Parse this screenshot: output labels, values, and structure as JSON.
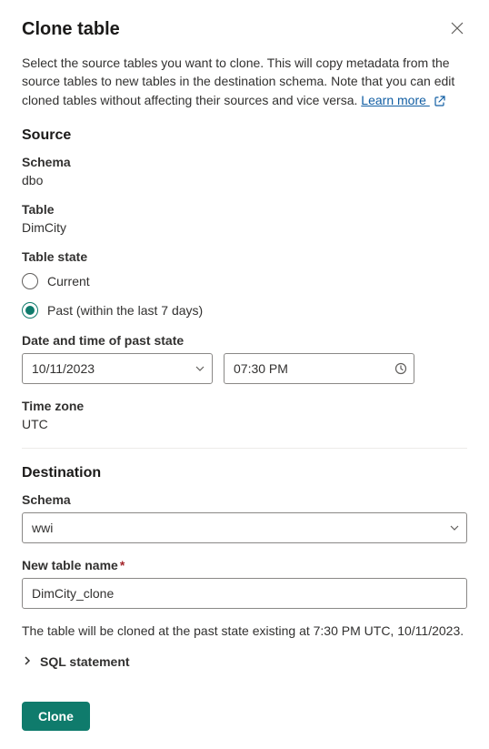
{
  "dialog": {
    "title": "Clone table",
    "description_prefix": "Select the source tables you want to clone. This will copy metadata from the source tables to new tables in the destination schema. Note that you can edit cloned tables without affecting their sources and vice versa. ",
    "learn_more_label": "Learn more "
  },
  "source": {
    "section_title": "Source",
    "schema_label": "Schema",
    "schema_value": "dbo",
    "table_label": "Table",
    "table_value": "DimCity",
    "table_state_label": "Table state",
    "radio_current": "Current",
    "radio_past": "Past (within the last 7 days)",
    "selected_state": "past",
    "datetime_label": "Date and time of past state",
    "date_value": "10/11/2023",
    "time_value": "07:30 PM",
    "timezone_label": "Time zone",
    "timezone_value": "UTC"
  },
  "destination": {
    "section_title": "Destination",
    "schema_label": "Schema",
    "schema_value": "wwi",
    "new_table_label": "New table name",
    "new_table_value": "DimCity_clone"
  },
  "footer": {
    "info_text": "The table will be cloned at the past state existing at 7:30 PM UTC, 10/11/2023.",
    "sql_statement_label": "SQL statement",
    "clone_button": "Clone"
  }
}
